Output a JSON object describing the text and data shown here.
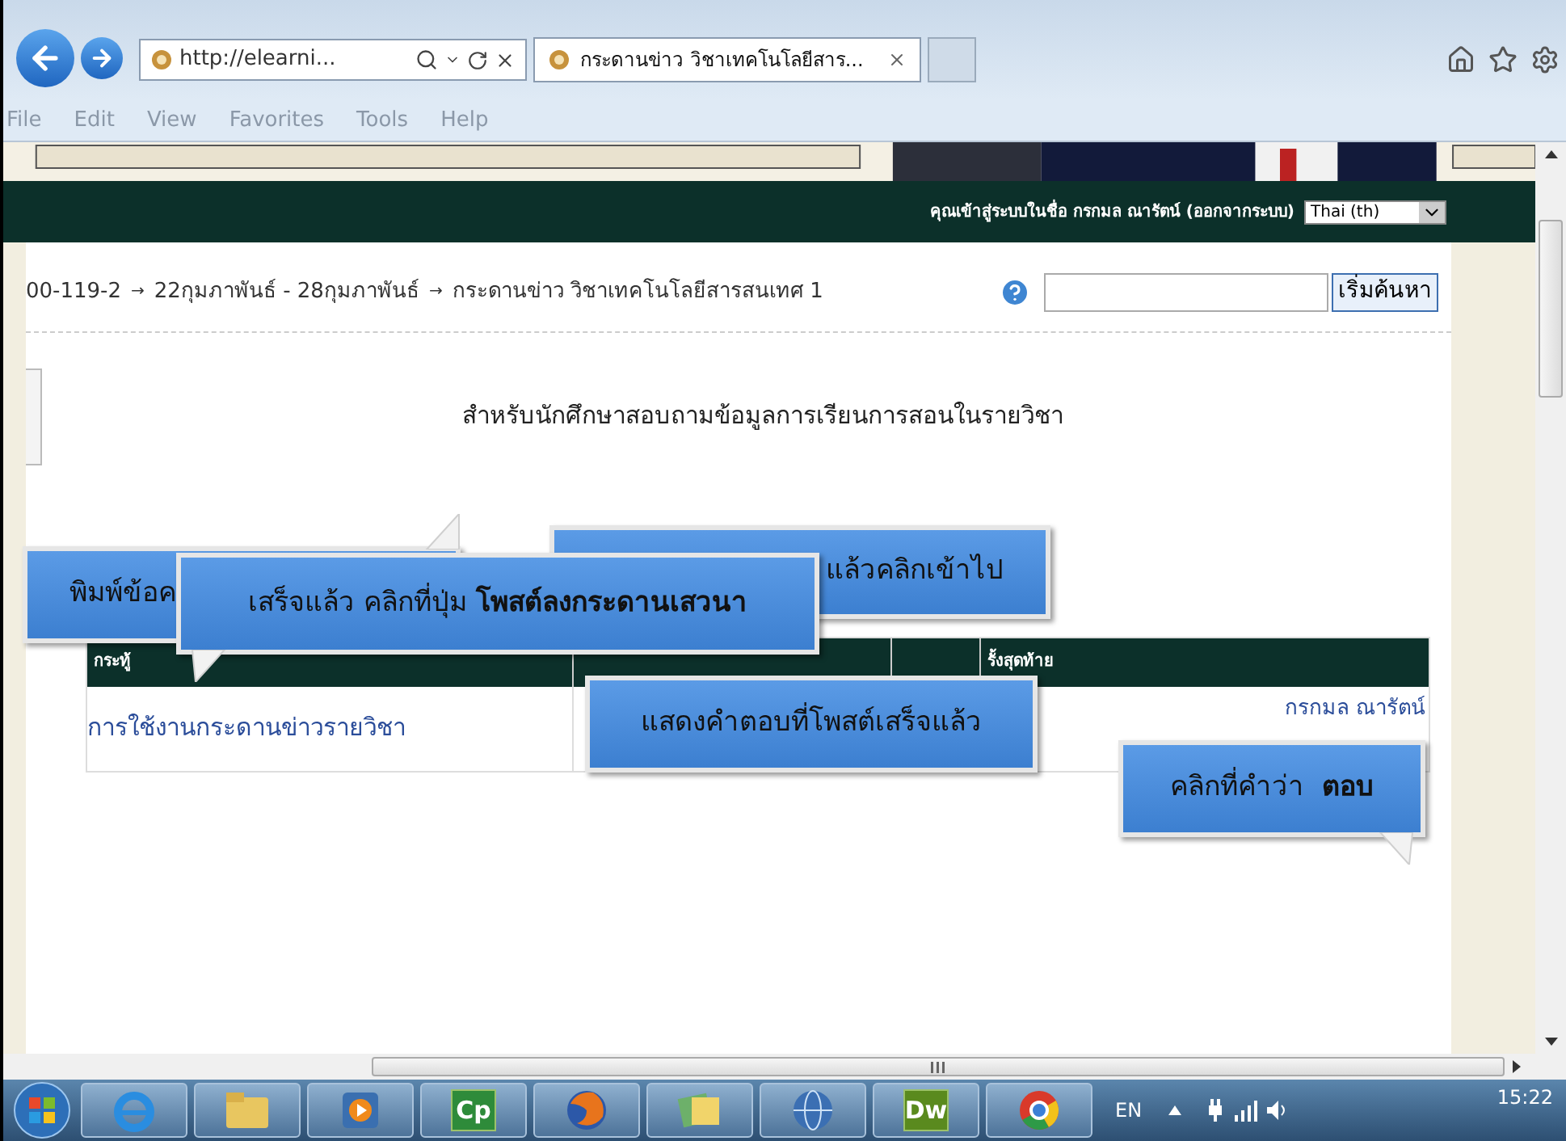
{
  "browser": {
    "address": "http://elearni...",
    "tabs": [
      {
        "title": "กระดานข่าว วิชาเทคโนโลยีสาร...",
        "selected": true
      }
    ],
    "menu": [
      "File",
      "Edit",
      "View",
      "Favorites",
      "Tools",
      "Help"
    ]
  },
  "header": {
    "login_text": "คุณเข้าสู่ระบบในชื่อ กรกมล ณารัตน์ (ออกจากระบบ)",
    "language": "Thai (th)"
  },
  "breadcrumb": {
    "items": [
      "00-119-2",
      "22กุมภาพันธ์ - 28กุมภาพันธ์",
      "กระดานข่าว วิชาเทคโนโลยีสารสนเทศ 1"
    ],
    "separator": "→"
  },
  "search": {
    "button": "เริ่มค้นหา"
  },
  "heading": "สำหรับนักศึกษาสอบถามข้อมูลการเรียนการสอนในรายวิชา",
  "table": {
    "column_1": "กระทู้",
    "column_4": "รั้งสุดท้าย",
    "rows": [
      {
        "topic": "การใช้งานกระดานข่าวรายวิชา",
        "last_post_author": "กรกมล ณารัตน์"
      }
    ]
  },
  "callouts": [
    {
      "text": "พิมพ์ข้อค",
      "kind": "tail-up"
    },
    {
      "text": "แล้วคลิกเข้าไป",
      "kind": "plain"
    },
    {
      "text": "เสร็จแล้ว คลิกที่ปุ่ม **โพสต์ลงกระดานเสวนา**",
      "kind": "tail-down-left"
    },
    {
      "text": "แสดงคำตอบที่โพสต์เสร็จแล้ว",
      "kind": "plain"
    },
    {
      "text": "คลิกที่คำว่า  **ตอบ**",
      "kind": "tail-down-right"
    }
  ],
  "taskbar": {
    "apps": [
      {
        "kind": "ie"
      },
      {
        "kind": "folder"
      },
      {
        "kind": "media"
      },
      {
        "kind": "badge",
        "label": "Cp",
        "color": "#2e8b3a"
      },
      {
        "kind": "firefox"
      },
      {
        "kind": "photos"
      },
      {
        "kind": "globe"
      },
      {
        "kind": "badge",
        "label": "Dw",
        "color": "#5a8a1e"
      },
      {
        "kind": "chrome"
      }
    ],
    "language": "EN",
    "clock": "15:22"
  }
}
